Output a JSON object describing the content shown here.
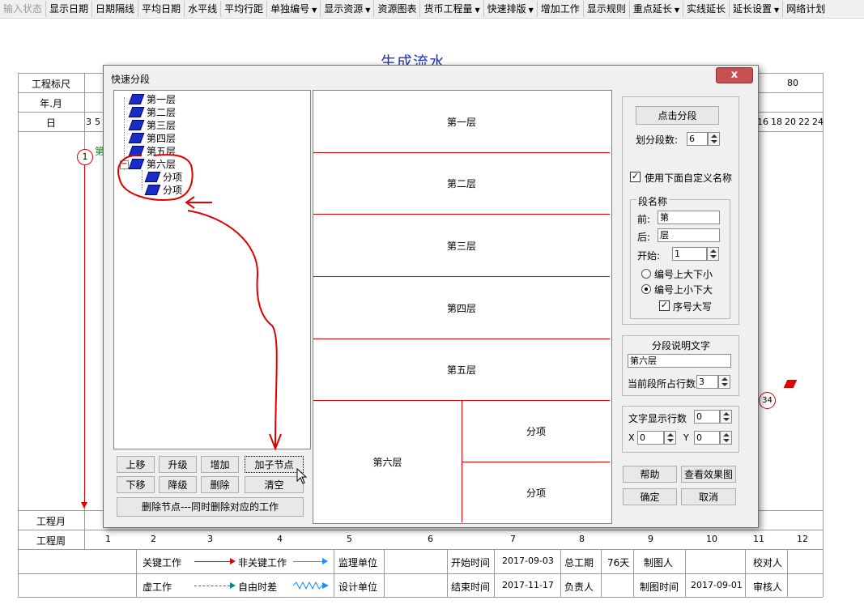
{
  "toolbar": {
    "items": [
      {
        "label": "输入状态",
        "disabled": true
      },
      {
        "label": "显示日期"
      },
      {
        "label": "日期隔线"
      },
      {
        "label": "平均日期"
      },
      {
        "label": "水平线"
      },
      {
        "label": "平均行距"
      },
      {
        "label": "单独编号",
        "dropdown": true
      },
      {
        "label": "显示资源",
        "dropdown": true
      },
      {
        "label": "资源图表"
      },
      {
        "label": "货币工程量",
        "dropdown": true
      },
      {
        "label": "快速排版",
        "dropdown": true
      },
      {
        "label": "增加工作"
      },
      {
        "label": "显示规则"
      },
      {
        "label": "重点延长",
        "dropdown": true
      },
      {
        "label": "实线延长"
      },
      {
        "label": "延长设置",
        "dropdown": true
      },
      {
        "label": "网络计划"
      }
    ]
  },
  "chart": {
    "title": "生成流水",
    "row_labels": {
      "scale": "工程标尺",
      "year_month": "年.月",
      "day": "日",
      "month": "工程月",
      "week": "工程周"
    },
    "scale_value": "80",
    "day_cells_left": [
      "3",
      "5"
    ],
    "day_cells_right": [
      "16",
      "18",
      "20",
      "22",
      "24"
    ],
    "week_numbers": [
      "1",
      "2",
      "3",
      "4",
      "5",
      "6",
      "7",
      "8",
      "9",
      "10",
      "11",
      "12"
    ],
    "node_start": "1",
    "node_end": "34",
    "first_task_fragment": "第",
    "footer": {
      "critical_work": "关键工作",
      "non_critical_work": "非关键工作",
      "virtual_work": "虚工作",
      "free_float": "自由时差",
      "supervisor_unit": "监理单位",
      "design_unit": "设计单位",
      "start_time_label": "开始时间",
      "start_time": "2017-09-03",
      "end_time_label": "结束时间",
      "end_time": "2017-11-17",
      "duration_label": "总工期",
      "duration": "76天",
      "responsible_label": "负责人",
      "drawer_label": "制图人",
      "draw_time_label": "制图时间",
      "draw_time": "2017-09-01",
      "checker_label": "校对人",
      "reviewer_label": "审核人"
    }
  },
  "dialog": {
    "title": "快速分段",
    "close_label": "x",
    "tree": {
      "nodes": [
        "第一层",
        "第二层",
        "第三层",
        "第四层",
        "第五层",
        "第六层"
      ],
      "children": [
        "分项",
        "分项"
      ],
      "expander": "−"
    },
    "buttons": {
      "move_up": "上移",
      "promote": "升级",
      "add": "增加",
      "add_child": "加子节点",
      "move_down": "下移",
      "demote": "降级",
      "delete": "删除",
      "clear": "清空",
      "delete_node": "删除节点---同时删除对应的工作"
    },
    "preview": {
      "segments": [
        "第一层",
        "第二层",
        "第三层",
        "第四层",
        "第五层"
      ],
      "last_segment": "第六层",
      "sub_segments": [
        "分项",
        "分项"
      ]
    },
    "settings": {
      "split_button": "点击分段",
      "split_count_label": "划分段数:",
      "split_count": "6",
      "use_custom_name_label": "使用下面自定义名称",
      "use_custom_name": true,
      "segment_name_group": "段名称",
      "prefix_label": "前:",
      "prefix": "第",
      "suffix_label": "后:",
      "suffix": "层",
      "start_label": "开始:",
      "start": "1",
      "order_top_big": "编号上大下小",
      "order_top_small": "编号上小下大",
      "order_selected": "top_small",
      "uppercase_label": "序号大写",
      "uppercase": true,
      "desc_group": "分段说明文字",
      "desc_text": "第六层",
      "rows_label": "当前段所占行数",
      "rows": "3",
      "text_rows_label": "文字显示行数",
      "text_rows": "0",
      "x_label": "X",
      "x": "0",
      "y_label": "Y",
      "y": "0",
      "help": "帮助",
      "preview_effect": "查看效果图",
      "ok": "确定",
      "cancel": "取消"
    }
  },
  "colors": {
    "accent_red": "#e00000",
    "title_blue": "#2233bb",
    "arrow_blue": "#1e8fff",
    "arrow_teal": "#008b8b"
  }
}
